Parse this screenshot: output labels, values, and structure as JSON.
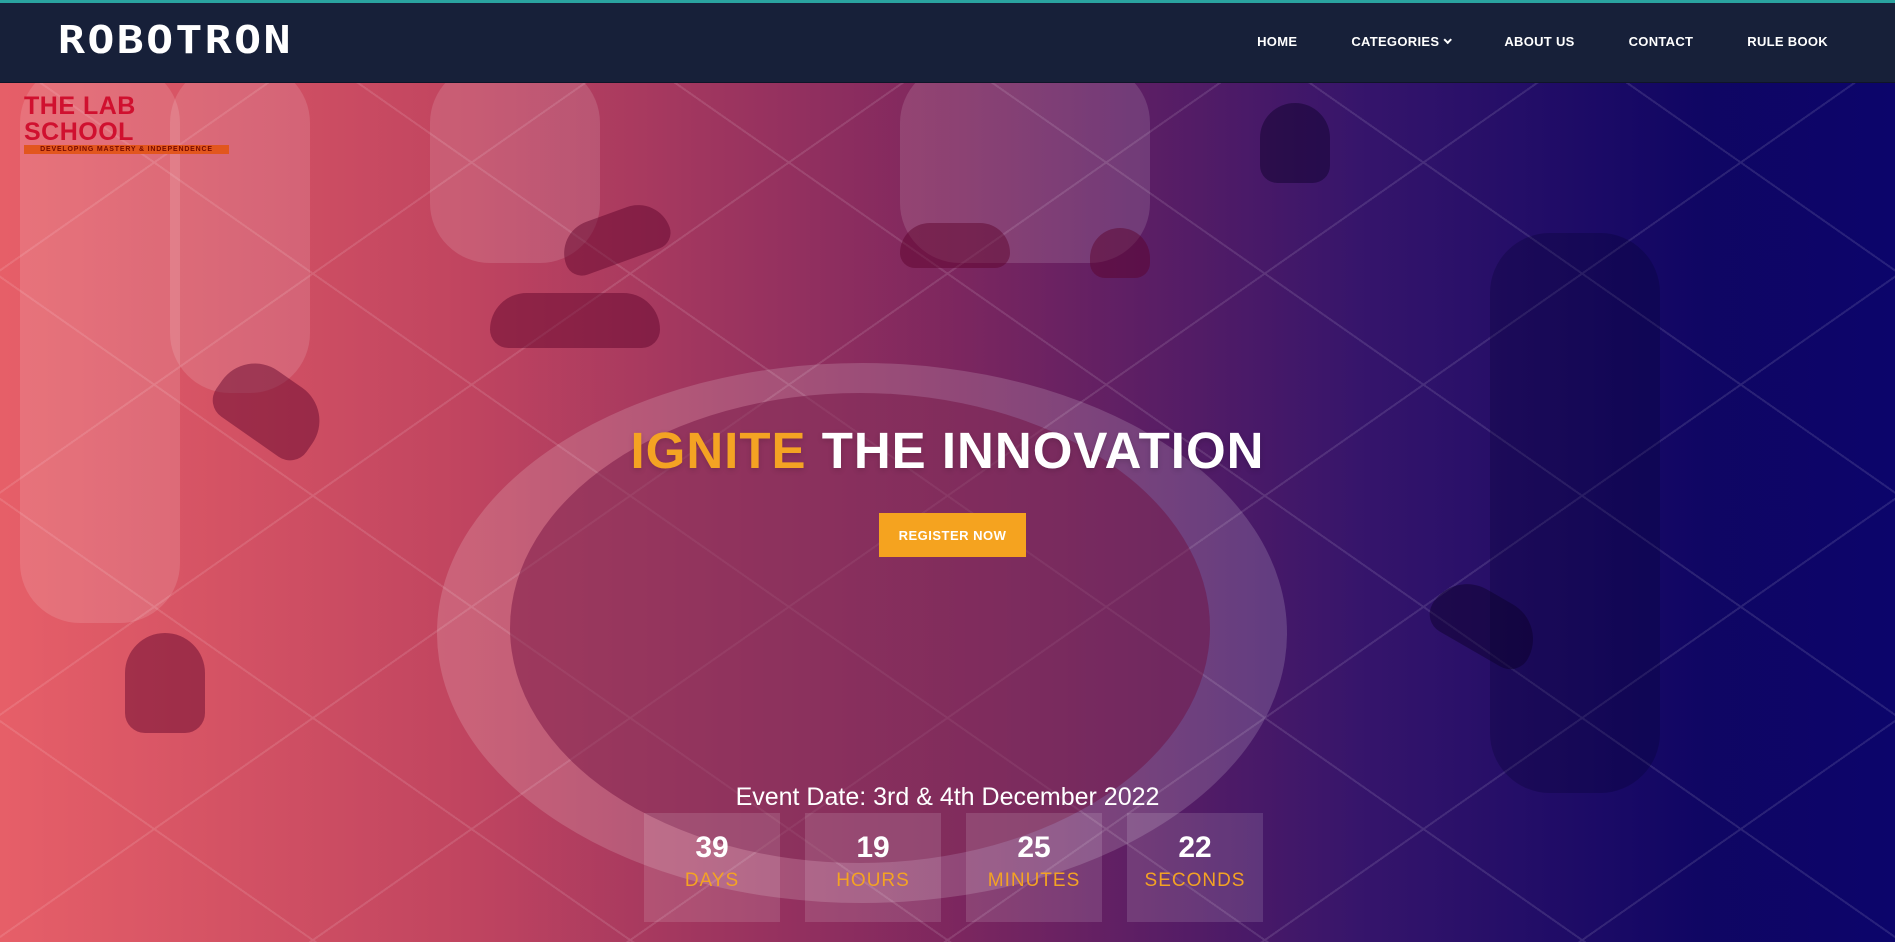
{
  "header": {
    "brand": "ROBOTRON",
    "nav": {
      "home": "HOME",
      "categories": "CATEGORIES",
      "about": "ABOUT US",
      "contact": "CONTACT",
      "rulebook": "RULE BOOK"
    }
  },
  "hero": {
    "logo": {
      "top_text": "",
      "name": "THE LAB SCHOOL",
      "tagline": "DEVELOPING MASTERY & INDEPENDENCE"
    },
    "headline_accent": "IGNITE",
    "headline_rest": "THE INNOVATION",
    "register_label": "REGISTER NOW",
    "event_date": "Event Date: 3rd & 4th December 2022",
    "countdown": [
      {
        "value": "39",
        "label": "DAYS"
      },
      {
        "value": "19",
        "label": "HOURS"
      },
      {
        "value": "25",
        "label": "MINUTES"
      },
      {
        "value": "22",
        "label": "SECONDS"
      }
    ]
  },
  "colors": {
    "navbar": "#172039",
    "accent": "#f4a323",
    "gradient_left": "#f6646c",
    "gradient_right": "#0c056b"
  },
  "icons": {
    "categories_dropdown": "chevron-down-icon"
  }
}
